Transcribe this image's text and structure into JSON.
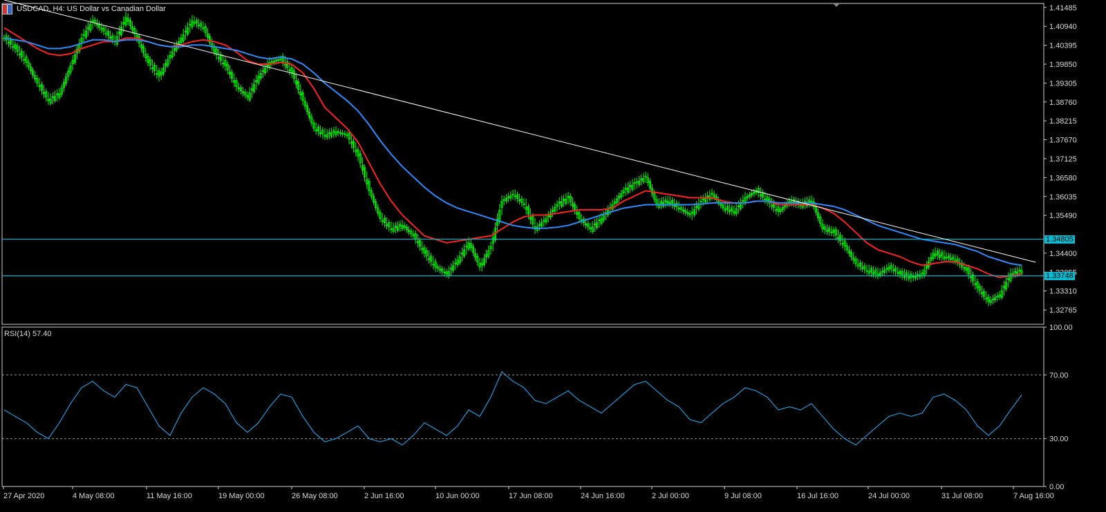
{
  "header": {
    "title": "USDCAD, H4:  US Dollar vs Canadian Dollar",
    "icon": "symbol-flag-icon"
  },
  "colors": {
    "background": "#000000",
    "candle": "#00ff00",
    "ma_fast": "#ff2020",
    "ma_slow": "#2a8cff",
    "rsi": "#1e9bdc",
    "level_line": "#00bcd4",
    "trend_line": "#ffffff"
  },
  "chart_data": [
    {
      "type": "candlestick",
      "title": "USDCAD, H4:  US Dollar vs Canadian Dollar",
      "x_ticks": [
        "27 Apr 2020",
        "4 May 08:00",
        "11 May 16:00",
        "19 May 00:00",
        "26 May 08:00",
        "2 Jun 16:00",
        "10 Jun 00:00",
        "17 Jun 08:00",
        "24 Jun 16:00",
        "2 Jul 00:00",
        "9 Jul 08:00",
        "16 Jul 16:00",
        "24 Jul 00:00",
        "31 Jul 08:00",
        "7 Aug 16:00"
      ],
      "y_ticks": [
        "1.41485",
        "1.40940",
        "1.40395",
        "1.39850",
        "1.39305",
        "1.38760",
        "1.38215",
        "1.37670",
        "1.37125",
        "1.36580",
        "1.36035",
        "1.35490",
        "1.34400",
        "1.33855",
        "1.33310",
        "1.32765"
      ],
      "ylim": [
        1.3235,
        1.416
      ],
      "close_series": [
        1.406,
        1.403,
        1.399,
        1.393,
        1.388,
        1.39,
        1.398,
        1.406,
        1.411,
        1.408,
        1.405,
        1.412,
        1.406,
        1.399,
        1.395,
        1.401,
        1.406,
        1.411,
        1.409,
        1.402,
        1.398,
        1.392,
        1.389,
        1.395,
        1.399,
        1.4,
        1.396,
        1.388,
        1.38,
        1.378,
        1.379,
        1.378,
        1.372,
        1.362,
        1.354,
        1.351,
        1.352,
        1.349,
        1.344,
        1.34,
        1.338,
        1.342,
        1.347,
        1.34,
        1.346,
        1.359,
        1.361,
        1.358,
        1.351,
        1.354,
        1.358,
        1.36,
        1.354,
        1.351,
        1.354,
        1.358,
        1.362,
        1.364,
        1.366,
        1.358,
        1.359,
        1.357,
        1.355,
        1.359,
        1.361,
        1.357,
        1.356,
        1.36,
        1.362,
        1.359,
        1.356,
        1.359,
        1.358,
        1.359,
        1.351,
        1.35,
        1.346,
        1.341,
        1.339,
        1.338,
        1.34,
        1.338,
        1.337,
        1.338,
        1.344,
        1.343,
        1.342,
        1.339,
        1.334,
        1.33,
        1.332,
        1.338,
        1.339
      ],
      "series": [
        {
          "name": "",
          "kind": "moving-average",
          "color": "#ff2020",
          "values": [
            1.409,
            1.407,
            1.405,
            1.403,
            1.4015,
            1.401,
            1.4015,
            1.403,
            1.404,
            1.405,
            1.405,
            1.406,
            1.406,
            1.405,
            1.404,
            1.4035,
            1.404,
            1.405,
            1.4055,
            1.405,
            1.404,
            1.402,
            1.3995,
            1.3985,
            1.3985,
            1.399,
            1.3985,
            1.396,
            1.3915,
            1.386,
            1.383,
            1.38,
            1.376,
            1.37,
            1.364,
            1.359,
            1.355,
            1.352,
            1.349,
            1.348,
            1.347,
            1.3475,
            1.348,
            1.3485,
            1.349,
            1.351,
            1.353,
            1.3545,
            1.355,
            1.355,
            1.3555,
            1.356,
            1.3565,
            1.3565,
            1.3565,
            1.357,
            1.359,
            1.3605,
            1.362,
            1.3615,
            1.361,
            1.3605,
            1.36,
            1.36,
            1.36,
            1.359,
            1.3585,
            1.3585,
            1.359,
            1.359,
            1.358,
            1.358,
            1.358,
            1.358,
            1.357,
            1.3555,
            1.353,
            1.35,
            1.347,
            1.345,
            1.344,
            1.343,
            1.3415,
            1.3405,
            1.341,
            1.3415,
            1.3415,
            1.3405,
            1.3395,
            1.338,
            1.337,
            1.3375,
            1.338
          ]
        },
        {
          "name": "",
          "kind": "moving-average",
          "color": "#2a8cff",
          "values": [
            1.406,
            1.4055,
            1.405,
            1.404,
            1.403,
            1.403,
            1.4035,
            1.4045,
            1.4055,
            1.4055,
            1.405,
            1.4055,
            1.4055,
            1.405,
            1.404,
            1.4035,
            1.4035,
            1.404,
            1.404,
            1.4035,
            1.403,
            1.4025,
            1.4015,
            1.4005,
            1.4,
            1.4005,
            1.4,
            1.3985,
            1.396,
            1.393,
            1.3905,
            1.388,
            1.385,
            1.381,
            1.3765,
            1.3725,
            1.369,
            1.366,
            1.363,
            1.3605,
            1.3585,
            1.357,
            1.356,
            1.355,
            1.354,
            1.353,
            1.352,
            1.3515,
            1.3512,
            1.3512,
            1.3515,
            1.352,
            1.353,
            1.354,
            1.355,
            1.356,
            1.357,
            1.3575,
            1.358,
            1.358,
            1.358,
            1.358,
            1.358,
            1.3582,
            1.3585,
            1.3585,
            1.3585,
            1.3585,
            1.359,
            1.359,
            1.3585,
            1.3585,
            1.3585,
            1.3585,
            1.358,
            1.3575,
            1.3565,
            1.355,
            1.3535,
            1.352,
            1.351,
            1.35,
            1.349,
            1.348,
            1.3475,
            1.347,
            1.3465,
            1.3455,
            1.3445,
            1.343,
            1.342,
            1.341,
            1.3405
          ]
        }
      ],
      "level_lines": [
        {
          "value": 1.34805,
          "label": "1.34805"
        },
        {
          "value": 1.33748,
          "label": "1.33748"
        }
      ],
      "trend_line": {
        "from": [
          0,
          1.417
        ],
        "to": [
          92,
          1.343
        ]
      }
    },
    {
      "type": "line",
      "title": "RSI(14) 57.40",
      "y_ticks": [
        "100.00",
        "70.00",
        "30.00",
        "0.00"
      ],
      "ylim": [
        0,
        100
      ],
      "reference_levels": [
        70,
        30
      ],
      "series": [
        {
          "name": "RSI(14)",
          "color": "#1e9bdc",
          "values": [
            48,
            44,
            40,
            34,
            30,
            40,
            52,
            62,
            66,
            60,
            56,
            64,
            62,
            50,
            38,
            32,
            46,
            56,
            62,
            58,
            52,
            40,
            34,
            40,
            50,
            58,
            56,
            44,
            34,
            28,
            30,
            34,
            38,
            30,
            28,
            30,
            26,
            32,
            40,
            36,
            32,
            38,
            48,
            44,
            56,
            72,
            66,
            62,
            54,
            52,
            56,
            60,
            54,
            50,
            46,
            52,
            58,
            64,
            66,
            60,
            54,
            50,
            42,
            40,
            46,
            52,
            56,
            62,
            60,
            56,
            48,
            50,
            48,
            52,
            44,
            36,
            30,
            26,
            32,
            38,
            44,
            46,
            44,
            46,
            56,
            58,
            54,
            48,
            38,
            32,
            38,
            48,
            57.4
          ]
        }
      ]
    }
  ]
}
